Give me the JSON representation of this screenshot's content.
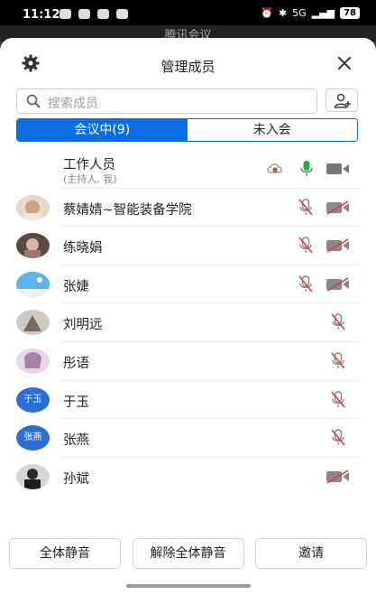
{
  "status": {
    "time": "11:12",
    "battery": "78",
    "network": "5G"
  },
  "behind_title": "腾讯会议",
  "header": {
    "title": "管理成员"
  },
  "search": {
    "placeholder": "搜索成员"
  },
  "tabs": [
    {
      "label": "会议中(9)"
    },
    {
      "label": "未入会"
    }
  ],
  "members": [
    {
      "name": "工作人员",
      "sub": "(主持人, 我)",
      "avatar": "",
      "icons": [
        "cloud-record-icon",
        "mic-on-icon",
        "video-off-icon"
      ]
    },
    {
      "name": "蔡婧婧~智能装备学院",
      "avatar": "",
      "icons": [
        "mic-muted-icon",
        "video-off-icon"
      ]
    },
    {
      "name": "练晓娟",
      "avatar": "",
      "icons": [
        "mic-muted-icon",
        "video-off-icon"
      ]
    },
    {
      "name": "张婕",
      "avatar": "",
      "icons": [
        "mic-muted-icon",
        "video-off-icon"
      ]
    },
    {
      "name": "刘明远",
      "avatar": "",
      "icons": [
        "mic-muted-icon"
      ]
    },
    {
      "name": "彤语",
      "avatar": "",
      "icons": [
        "mic-muted-icon"
      ]
    },
    {
      "name": "于玉",
      "avatar": "于玉",
      "icons": [
        "mic-muted-icon"
      ]
    },
    {
      "name": "张燕",
      "avatar": "张燕",
      "icons": [
        "mic-muted-icon"
      ]
    },
    {
      "name": "孙斌",
      "avatar": "",
      "icons": [
        "video-off-icon"
      ]
    }
  ],
  "actions": {
    "mute_all": "全体静音",
    "unmute_all": "解除全体静音",
    "invite": "邀请"
  },
  "colors": {
    "accent": "#0b6fe3",
    "record": "#e53935"
  }
}
